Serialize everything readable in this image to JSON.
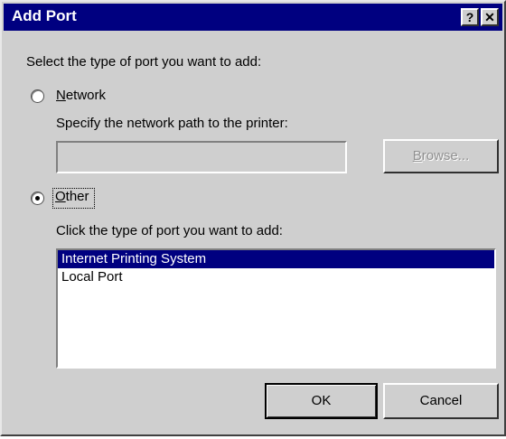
{
  "window": {
    "title": "Add Port",
    "help_glyph": "?",
    "close_glyph": "✕"
  },
  "prompt": "Select the type of port you want to add:",
  "network": {
    "label_access_key": "N",
    "label_rest": "etwork",
    "selected": false,
    "path_label": "Specify the network path to the printer:",
    "path_value": "",
    "browse_access_key": "B",
    "browse_rest": "rowse..."
  },
  "other": {
    "label_access_key": "O",
    "label_rest": "ther",
    "selected": true,
    "list_label": "Click the type of port you want to add:",
    "port_types": [
      {
        "label": "Internet Printing System",
        "selected": true
      },
      {
        "label": "Local Port",
        "selected": false
      }
    ]
  },
  "buttons": {
    "ok": "OK",
    "cancel": "Cancel"
  },
  "colors": {
    "title_bar": "#000080",
    "face": "#cfcfcf",
    "selection": "#000080"
  }
}
